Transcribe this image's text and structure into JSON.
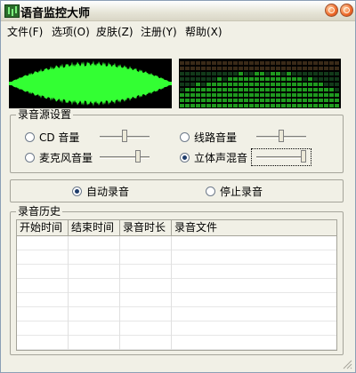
{
  "window": {
    "title": "语音监控大师"
  },
  "menu": [
    {
      "label": "文件(F)"
    },
    {
      "label": "选项(O)"
    },
    {
      "label": "皮肤(Z)"
    },
    {
      "label": "注册(Y)"
    },
    {
      "label": "帮助(X)"
    }
  ],
  "source_group": {
    "title": "录音源设置",
    "options": [
      {
        "label": "CD 音量",
        "selected": false,
        "volume_level": 0.5
      },
      {
        "label": "线路音量",
        "selected": false,
        "volume_level": 0.5
      },
      {
        "label": "麦克风音量",
        "selected": false,
        "volume_level": 0.8
      },
      {
        "label": "立体声混音",
        "selected": true,
        "volume_level": 1.0
      }
    ]
  },
  "record_mode": {
    "options": [
      {
        "label": "自动录音",
        "selected": true
      },
      {
        "label": "停止录音",
        "selected": false
      }
    ]
  },
  "history": {
    "title": "录音历史",
    "columns": [
      "开始时间",
      "结束时间",
      "录音时长",
      "录音文件"
    ],
    "rows": []
  },
  "colors": {
    "waveform": "#33ff33",
    "spectrum_low": "#1f9a1f",
    "spectrum_high": "#b8b43a",
    "panel_bg": "#000000",
    "window_bg": "#f1f0e6"
  }
}
